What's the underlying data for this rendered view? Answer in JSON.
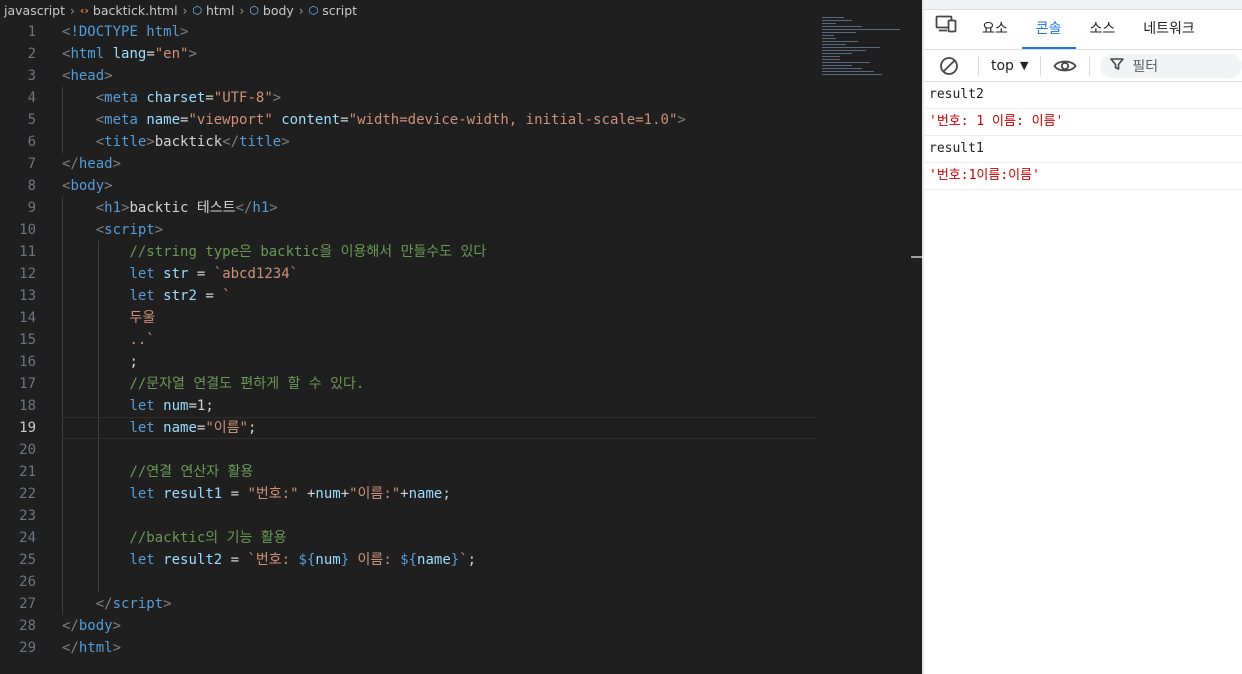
{
  "breadcrumb": {
    "folder": "javascript",
    "file": "backtick.html",
    "node_html": "html",
    "node_body": "body",
    "node_script": "script"
  },
  "editor": {
    "current_line": 19,
    "lines": [
      {
        "n": "1",
        "tokens": [
          [
            "c-punc",
            "<"
          ],
          [
            "c-tag",
            "!DOCTYPE html"
          ],
          [
            "c-punc",
            ">"
          ]
        ]
      },
      {
        "n": "2",
        "tokens": [
          [
            "c-punc",
            "<"
          ],
          [
            "c-tag",
            "html"
          ],
          [
            "c-txt",
            " "
          ],
          [
            "c-attr",
            "lang"
          ],
          [
            "c-txt",
            "="
          ],
          [
            "c-str",
            "\"en\""
          ],
          [
            "c-punc",
            ">"
          ]
        ]
      },
      {
        "n": "3",
        "tokens": [
          [
            "c-punc",
            "<"
          ],
          [
            "c-tag",
            "head"
          ],
          [
            "c-punc",
            ">"
          ]
        ]
      },
      {
        "n": "4",
        "tokens": [
          [
            "c-txt",
            "    "
          ],
          [
            "c-punc",
            "<"
          ],
          [
            "c-tag",
            "meta"
          ],
          [
            "c-txt",
            " "
          ],
          [
            "c-attr",
            "charset"
          ],
          [
            "c-txt",
            "="
          ],
          [
            "c-str",
            "\"UTF-8\""
          ],
          [
            "c-punc",
            ">"
          ]
        ]
      },
      {
        "n": "5",
        "tokens": [
          [
            "c-txt",
            "    "
          ],
          [
            "c-punc",
            "<"
          ],
          [
            "c-tag",
            "meta"
          ],
          [
            "c-txt",
            " "
          ],
          [
            "c-attr",
            "name"
          ],
          [
            "c-txt",
            "="
          ],
          [
            "c-str",
            "\"viewport\""
          ],
          [
            "c-txt",
            " "
          ],
          [
            "c-attr",
            "content"
          ],
          [
            "c-txt",
            "="
          ],
          [
            "c-str",
            "\"width=device-width, initial-scale=1.0\""
          ],
          [
            "c-punc",
            ">"
          ]
        ]
      },
      {
        "n": "6",
        "tokens": [
          [
            "c-txt",
            "    "
          ],
          [
            "c-punc",
            "<"
          ],
          [
            "c-tag",
            "title"
          ],
          [
            "c-punc",
            ">"
          ],
          [
            "c-txt",
            "backtick"
          ],
          [
            "c-punc",
            "</"
          ],
          [
            "c-tag",
            "title"
          ],
          [
            "c-punc",
            ">"
          ]
        ]
      },
      {
        "n": "7",
        "tokens": [
          [
            "c-punc",
            "</"
          ],
          [
            "c-tag",
            "head"
          ],
          [
            "c-punc",
            ">"
          ]
        ]
      },
      {
        "n": "8",
        "tokens": [
          [
            "c-punc",
            "<"
          ],
          [
            "c-tag",
            "body"
          ],
          [
            "c-punc",
            ">"
          ]
        ]
      },
      {
        "n": "9",
        "tokens": [
          [
            "c-txt",
            "    "
          ],
          [
            "c-punc",
            "<"
          ],
          [
            "c-tag",
            "h1"
          ],
          [
            "c-punc",
            ">"
          ],
          [
            "c-txt",
            "backtic 테스트"
          ],
          [
            "c-punc",
            "</"
          ],
          [
            "c-tag",
            "h1"
          ],
          [
            "c-punc",
            ">"
          ]
        ]
      },
      {
        "n": "10",
        "tokens": [
          [
            "c-txt",
            "    "
          ],
          [
            "c-punc",
            "<"
          ],
          [
            "c-tag",
            "script"
          ],
          [
            "c-punc",
            ">"
          ]
        ]
      },
      {
        "n": "11",
        "tokens": [
          [
            "c-txt",
            "        "
          ],
          [
            "c-cmt",
            "//string type은 backtic을 이용해서 만들수도 있다"
          ]
        ]
      },
      {
        "n": "12",
        "tokens": [
          [
            "c-txt",
            "        "
          ],
          [
            "c-kw",
            "let"
          ],
          [
            "c-txt",
            " "
          ],
          [
            "c-var",
            "str"
          ],
          [
            "c-txt",
            " = "
          ],
          [
            "c-str",
            "`abcd1234`"
          ]
        ]
      },
      {
        "n": "13",
        "tokens": [
          [
            "c-txt",
            "        "
          ],
          [
            "c-kw",
            "let"
          ],
          [
            "c-txt",
            " "
          ],
          [
            "c-var",
            "str2"
          ],
          [
            "c-txt",
            " = "
          ],
          [
            "c-str",
            "`"
          ]
        ]
      },
      {
        "n": "14",
        "tokens": [
          [
            "c-txt",
            "        "
          ],
          [
            "c-str",
            "두울"
          ]
        ]
      },
      {
        "n": "15",
        "tokens": [
          [
            "c-txt",
            "        "
          ],
          [
            "c-str",
            "..`"
          ]
        ]
      },
      {
        "n": "16",
        "tokens": [
          [
            "c-txt",
            "        "
          ],
          [
            "c-txt",
            ";"
          ]
        ]
      },
      {
        "n": "17",
        "tokens": [
          [
            "c-txt",
            "        "
          ],
          [
            "c-cmt",
            "//문자열 연결도 편하게 할 수 있다."
          ]
        ]
      },
      {
        "n": "18",
        "tokens": [
          [
            "c-txt",
            "        "
          ],
          [
            "c-kw",
            "let"
          ],
          [
            "c-txt",
            " "
          ],
          [
            "c-var",
            "num"
          ],
          [
            "c-txt",
            "=1;"
          ]
        ]
      },
      {
        "n": "19",
        "tokens": [
          [
            "c-txt",
            "        "
          ],
          [
            "c-kw",
            "let"
          ],
          [
            "c-txt",
            " "
          ],
          [
            "c-var",
            "name"
          ],
          [
            "c-txt",
            "="
          ],
          [
            "c-str",
            "\"이름\""
          ],
          [
            "c-txt",
            ";"
          ]
        ]
      },
      {
        "n": "20",
        "tokens": []
      },
      {
        "n": "21",
        "tokens": [
          [
            "c-txt",
            "        "
          ],
          [
            "c-cmt",
            "//연결 연산자 활용"
          ]
        ]
      },
      {
        "n": "22",
        "tokens": [
          [
            "c-txt",
            "        "
          ],
          [
            "c-kw",
            "let"
          ],
          [
            "c-txt",
            " "
          ],
          [
            "c-var",
            "result1"
          ],
          [
            "c-txt",
            " = "
          ],
          [
            "c-str",
            "\"번호:\""
          ],
          [
            "c-txt",
            " +"
          ],
          [
            "c-var",
            "num"
          ],
          [
            "c-txt",
            "+"
          ],
          [
            "c-str",
            "\"이름:\""
          ],
          [
            "c-txt",
            "+"
          ],
          [
            "c-var",
            "name"
          ],
          [
            "c-txt",
            ";"
          ]
        ]
      },
      {
        "n": "23",
        "tokens": []
      },
      {
        "n": "24",
        "tokens": [
          [
            "c-txt",
            "        "
          ],
          [
            "c-cmt",
            "//backtic의 기능 활용"
          ]
        ]
      },
      {
        "n": "25",
        "tokens": [
          [
            "c-txt",
            "        "
          ],
          [
            "c-kw",
            "let"
          ],
          [
            "c-txt",
            " "
          ],
          [
            "c-var",
            "result2"
          ],
          [
            "c-txt",
            " = "
          ],
          [
            "c-str",
            "`번호: "
          ],
          [
            "c-kw",
            "${"
          ],
          [
            "c-var",
            "num"
          ],
          [
            "c-kw",
            "}"
          ],
          [
            "c-str",
            " 이름: "
          ],
          [
            "c-kw",
            "${"
          ],
          [
            "c-var",
            "name"
          ],
          [
            "c-kw",
            "}"
          ],
          [
            "c-str",
            "`"
          ],
          [
            "c-txt",
            ";"
          ]
        ]
      },
      {
        "n": "26",
        "tokens": []
      },
      {
        "n": "27",
        "tokens": [
          [
            "c-txt",
            "    "
          ],
          [
            "c-punc",
            "</"
          ],
          [
            "c-tag",
            "script"
          ],
          [
            "c-punc",
            ">"
          ]
        ]
      },
      {
        "n": "28",
        "tokens": [
          [
            "c-punc",
            "</"
          ],
          [
            "c-tag",
            "body"
          ],
          [
            "c-punc",
            ">"
          ]
        ]
      },
      {
        "n": "29",
        "tokens": [
          [
            "c-punc",
            "</"
          ],
          [
            "c-tag",
            "html"
          ],
          [
            "c-punc",
            ">"
          ]
        ]
      }
    ]
  },
  "devtools": {
    "tabs": [
      {
        "label": "요소",
        "active": false
      },
      {
        "label": "콘솔",
        "active": true
      },
      {
        "label": "소스",
        "active": false
      },
      {
        "label": "네트워크",
        "active": false
      }
    ],
    "device_icon": "device-toolbar-icon",
    "toolbar": {
      "context": "top",
      "filter_placeholder": "필터",
      "clear_icon": "clear-console-icon",
      "eye_icon": "live-expression-eye-icon",
      "filter_icon": "filter-icon"
    },
    "console": [
      {
        "text": "result2",
        "kind": "log"
      },
      {
        "text": "'번호: 1 이름: 이름'",
        "kind": "string"
      },
      {
        "text": "result1",
        "kind": "log"
      },
      {
        "text": "'번호:1이름:이름'",
        "kind": "string"
      }
    ]
  },
  "colors": {
    "editor_bg": "#1f1f1f",
    "keyword": "#569cd6",
    "string": "#ce9178",
    "comment": "#6a9955",
    "variable": "#9cdcfe",
    "active_tab": "#1a73e8",
    "console_string": "#c80000"
  }
}
